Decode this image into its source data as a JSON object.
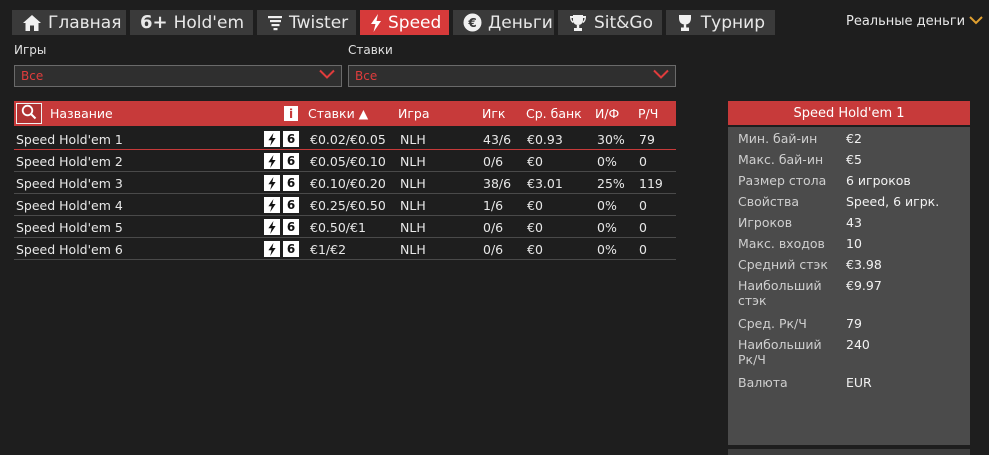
{
  "nav": {
    "tabs": [
      {
        "label": "Главная",
        "icon": "home-icon",
        "active": false
      },
      {
        "label": "Hold'em",
        "prefix": "6+",
        "icon": "six-plus-icon",
        "active": false
      },
      {
        "label": "Twister",
        "icon": "tornado-icon",
        "active": false
      },
      {
        "label": "Speed",
        "icon": "lightning-icon",
        "active": true
      },
      {
        "label": "Деньги",
        "icon": "euro-coin-icon",
        "active": false
      },
      {
        "label": "Sit&Go",
        "icon": "trophy-icon",
        "active": false
      },
      {
        "label": "Турнир",
        "icon": "cup-icon",
        "active": false
      }
    ],
    "money_mode": "Реальные деньги"
  },
  "filters": {
    "games_label": "Игры",
    "games_value": "Все",
    "stakes_label": "Ставки",
    "stakes_value": "Все"
  },
  "table": {
    "headers": {
      "name": "Название",
      "stakes": "Ставки ▲",
      "game": "Игра",
      "players": "Игк",
      "avg_pot": "Ср. банк",
      "flop": "И/Ф",
      "hands": "Р/Ч"
    },
    "rows": [
      {
        "name": "Speed Hold'em 1",
        "seats": "6",
        "stakes": "€0.02/€0.05",
        "game": "NLH",
        "players": "43/6",
        "avg_pot": "€0.93",
        "flop": "30%",
        "hands": "79"
      },
      {
        "name": "Speed Hold'em 2",
        "seats": "6",
        "stakes": "€0.05/€0.10",
        "game": "NLH",
        "players": "0/6",
        "avg_pot": "€0",
        "flop": "0%",
        "hands": "0"
      },
      {
        "name": "Speed Hold'em 3",
        "seats": "6",
        "stakes": "€0.10/€0.20",
        "game": "NLH",
        "players": "38/6",
        "avg_pot": "€3.01",
        "flop": "25%",
        "hands": "119"
      },
      {
        "name": "Speed Hold'em 4",
        "seats": "6",
        "stakes": "€0.25/€0.50",
        "game": "NLH",
        "players": "1/6",
        "avg_pot": "€0",
        "flop": "0%",
        "hands": "0"
      },
      {
        "name": "Speed Hold'em 5",
        "seats": "6",
        "stakes": "€0.50/€1",
        "game": "NLH",
        "players": "0/6",
        "avg_pot": "€0",
        "flop": "0%",
        "hands": "0"
      },
      {
        "name": "Speed Hold'em 6",
        "seats": "6",
        "stakes": "€1/€2",
        "game": "NLH",
        "players": "0/6",
        "avg_pot": "€0",
        "flop": "0%",
        "hands": "0"
      }
    ]
  },
  "details": {
    "title": "Speed Hold'em 1",
    "fields": [
      {
        "label": "Мин. бай-ин",
        "value": "€2"
      },
      {
        "label": "Макс. бай-ин",
        "value": "€5"
      },
      {
        "label": "Размер стола",
        "value": "6 игроков"
      },
      {
        "label": "Свойства",
        "value": "Speed, 6 игрк."
      },
      {
        "label": "Игроков",
        "value": "43"
      },
      {
        "label": "Макс. входов",
        "value": "10"
      },
      {
        "label": "Средний стэк",
        "value": "€3.98"
      },
      {
        "label": "Наибольший стэк",
        "value": "€9.97"
      },
      {
        "label": "Сред. Рк/Ч",
        "value": "79"
      },
      {
        "label": "Наибольший Рк/Ч",
        "value": "240"
      },
      {
        "label": "Валюта",
        "value": "EUR"
      }
    ]
  },
  "colors": {
    "accent": "#c73a3a",
    "active_tab": "#d63a3a",
    "gold": "#e0a030"
  }
}
